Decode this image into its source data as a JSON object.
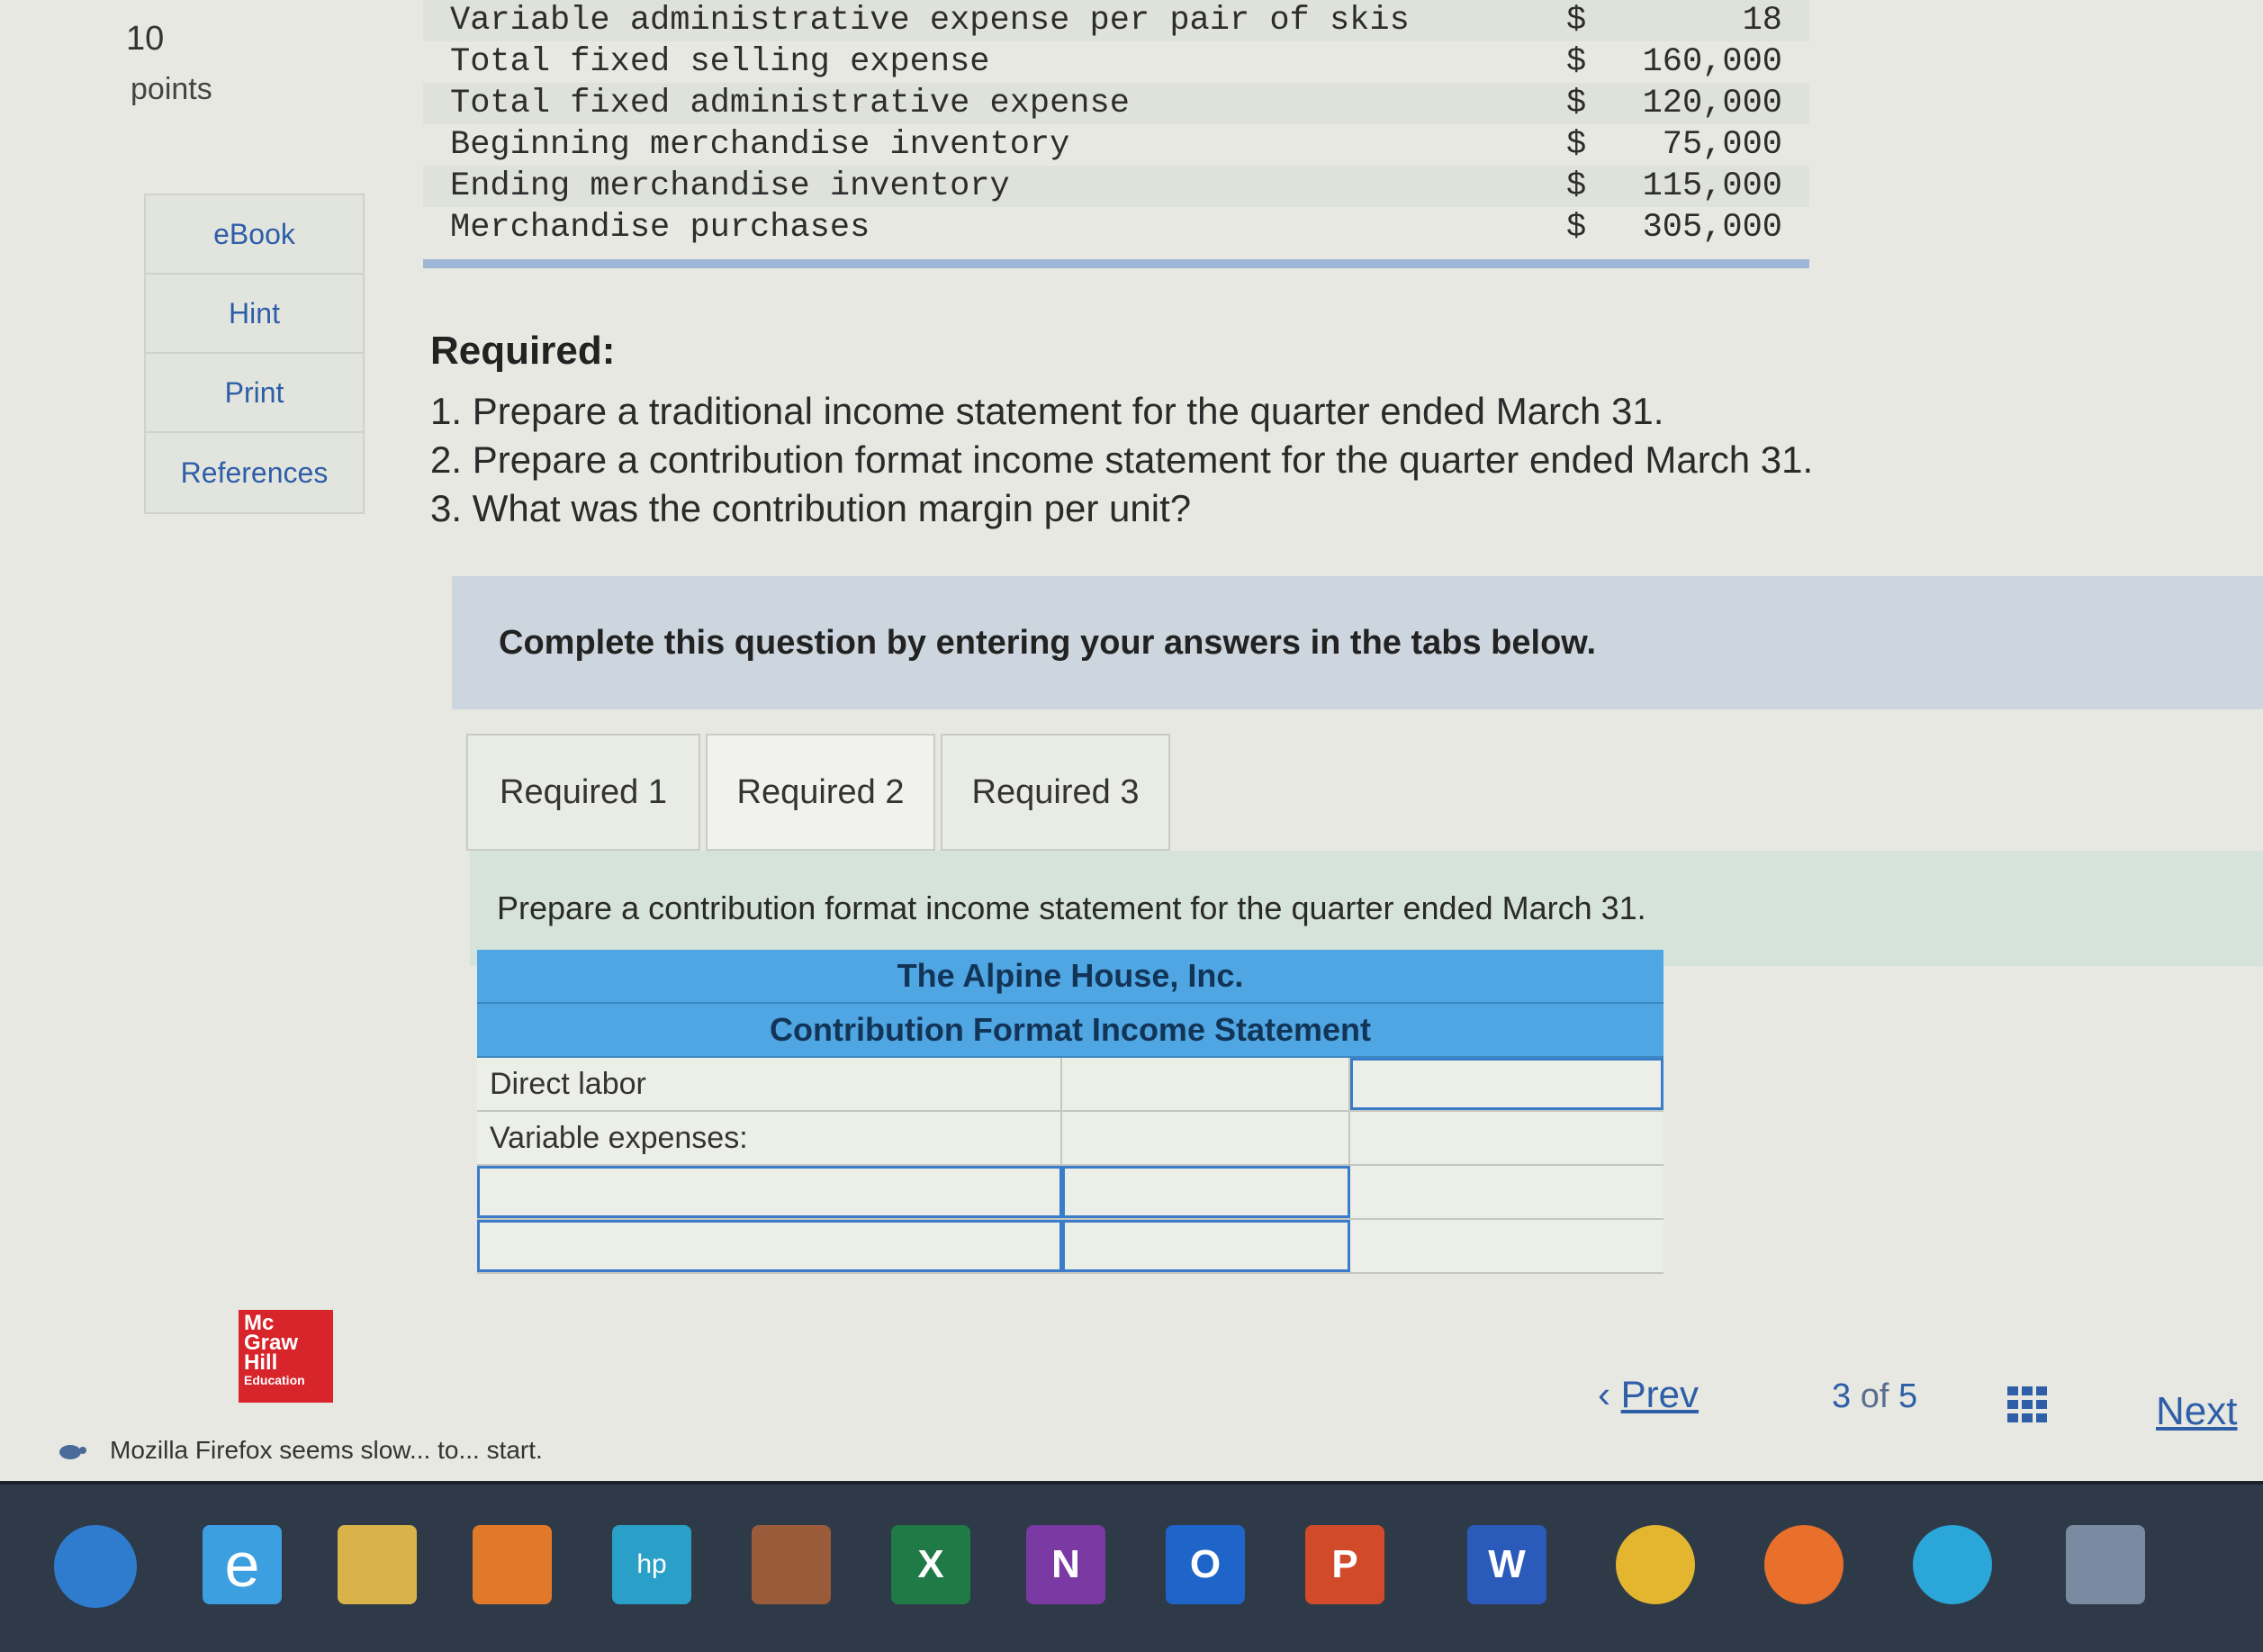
{
  "question": {
    "number": "10",
    "points_label": "points"
  },
  "side_tools": [
    "eBook",
    "Hint",
    "Print",
    "References"
  ],
  "data_table": [
    {
      "label": "Variable administrative expense per pair of skis",
      "currency": "$",
      "value": "18"
    },
    {
      "label": "Total fixed selling expense",
      "currency": "$",
      "value": "160,000"
    },
    {
      "label": "Total fixed administrative expense",
      "currency": "$",
      "value": "120,000"
    },
    {
      "label": "Beginning merchandise inventory",
      "currency": "$",
      "value": "75,000"
    },
    {
      "label": "Ending merchandise inventory",
      "currency": "$",
      "value": "115,000"
    },
    {
      "label": "Merchandise purchases",
      "currency": "$",
      "value": "305,000"
    }
  ],
  "required": {
    "title": "Required:",
    "items": [
      "1. Prepare a traditional income statement for the quarter ended March 31.",
      "2. Prepare a contribution format income statement for the quarter ended March 31.",
      "3. What was the contribution margin per unit?"
    ]
  },
  "banner": "Complete this question by entering your answers in the tabs below.",
  "tabs": [
    "Required 1",
    "Required 2",
    "Required 3"
  ],
  "active_tab": "Required 2",
  "instruction": "Prepare a contribution format income statement for the quarter ended March 31.",
  "statement": {
    "company": "The Alpine House, Inc.",
    "title": "Contribution Format Income Statement",
    "rows": [
      {
        "label": "Direct labor"
      },
      {
        "label": "Variable expenses:"
      },
      {
        "label": ""
      },
      {
        "label": ""
      },
      {
        "label": ""
      }
    ]
  },
  "logo": {
    "line1": "Mc",
    "line2": "Graw",
    "line3": "Hill",
    "line4": "Education"
  },
  "pagination": {
    "prev": "Prev",
    "current": "3",
    "of_label": "of",
    "total": "5",
    "next": "Next"
  },
  "status_text": "Mozilla Firefox seems slow... to... start.",
  "taskbar_icons": [
    {
      "name": "start-icon",
      "label": "",
      "color": "#2f7ccf"
    },
    {
      "name": "internet-explorer-icon",
      "label": "e",
      "color": "#3c9fe0"
    },
    {
      "name": "file-explorer-icon",
      "label": "",
      "color": "#d9b24a"
    },
    {
      "name": "media-player-icon",
      "label": "",
      "color": "#e07a2a"
    },
    {
      "name": "hp-icon",
      "label": "hp",
      "color": "#2aa0c8"
    },
    {
      "name": "app-icon",
      "label": "",
      "color": "#9a5b3a"
    },
    {
      "name": "excel-icon",
      "label": "X",
      "color": "#1f7a46"
    },
    {
      "name": "onenote-icon",
      "label": "N",
      "color": "#7b3aa3"
    },
    {
      "name": "outlook-icon",
      "label": "O",
      "color": "#1f64c8"
    },
    {
      "name": "powerpoint-icon",
      "label": "P",
      "color": "#d14a2a"
    },
    {
      "name": "word-icon",
      "label": "W",
      "color": "#2a5aba"
    },
    {
      "name": "chrome-icon",
      "label": "",
      "color": "#e4b630"
    },
    {
      "name": "firefox-icon",
      "label": "",
      "color": "#e8702a"
    },
    {
      "name": "edge-icon",
      "label": "",
      "color": "#2aa6d8"
    },
    {
      "name": "tray-icon",
      "label": "",
      "color": "#7a8aa0"
    }
  ]
}
